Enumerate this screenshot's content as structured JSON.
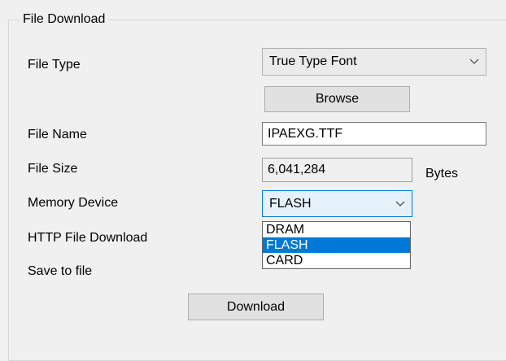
{
  "group": {
    "title": "File Download"
  },
  "fields": {
    "file_type_label": "File Type",
    "file_type_value": "True Type Font",
    "browse_label": "Browse",
    "file_name_label": "File Name",
    "file_name_value": "IPAEXG.TTF",
    "file_size_label": "File Size",
    "file_size_value": "6,041,284",
    "file_size_unit": "Bytes",
    "memory_device_label": "Memory Device",
    "memory_device_value": "FLASH",
    "http_download_label": "HTTP File Download",
    "save_to_file_label": "Save to file"
  },
  "memory_device_options": [
    "DRAM",
    "FLASH",
    "CARD"
  ],
  "memory_device_selected_index": 1,
  "download_button_label": "Download",
  "icons": {
    "dropdown_arrow": "chevron-down-icon"
  },
  "colors": {
    "window_bg": "#f0f0f0",
    "selection": "#0078d7",
    "focus_bg": "#e5f1fb"
  }
}
